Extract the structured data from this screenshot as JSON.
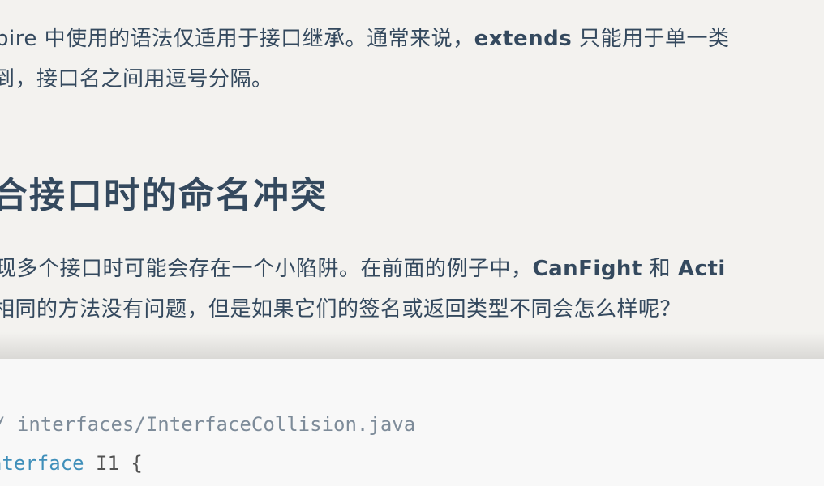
{
  "para1": {
    "line1_pre": "pire 中使用的语法仅适用于接口继承。通常来说，",
    "line1_bold": "extends",
    "line1_post": " 只能用于单一类",
    "line2": "到，接口名之间用逗号分隔。"
  },
  "heading": "合接口时的命名冲突",
  "para2": {
    "line1_pre": "现多个接口时可能会存在一个小陷阱。在前面的例子中，",
    "line1_bold1": "CanFight",
    "line1_mid": " 和 ",
    "line1_bold2": "Acti",
    "line2": "相同的方法没有问题，但是如果它们的签名或返回类型不同会怎么样呢？"
  },
  "code": {
    "comment": "/ interfaces/InterfaceCollision.java",
    "keyword": "nterface",
    "rest": " I1 {"
  }
}
